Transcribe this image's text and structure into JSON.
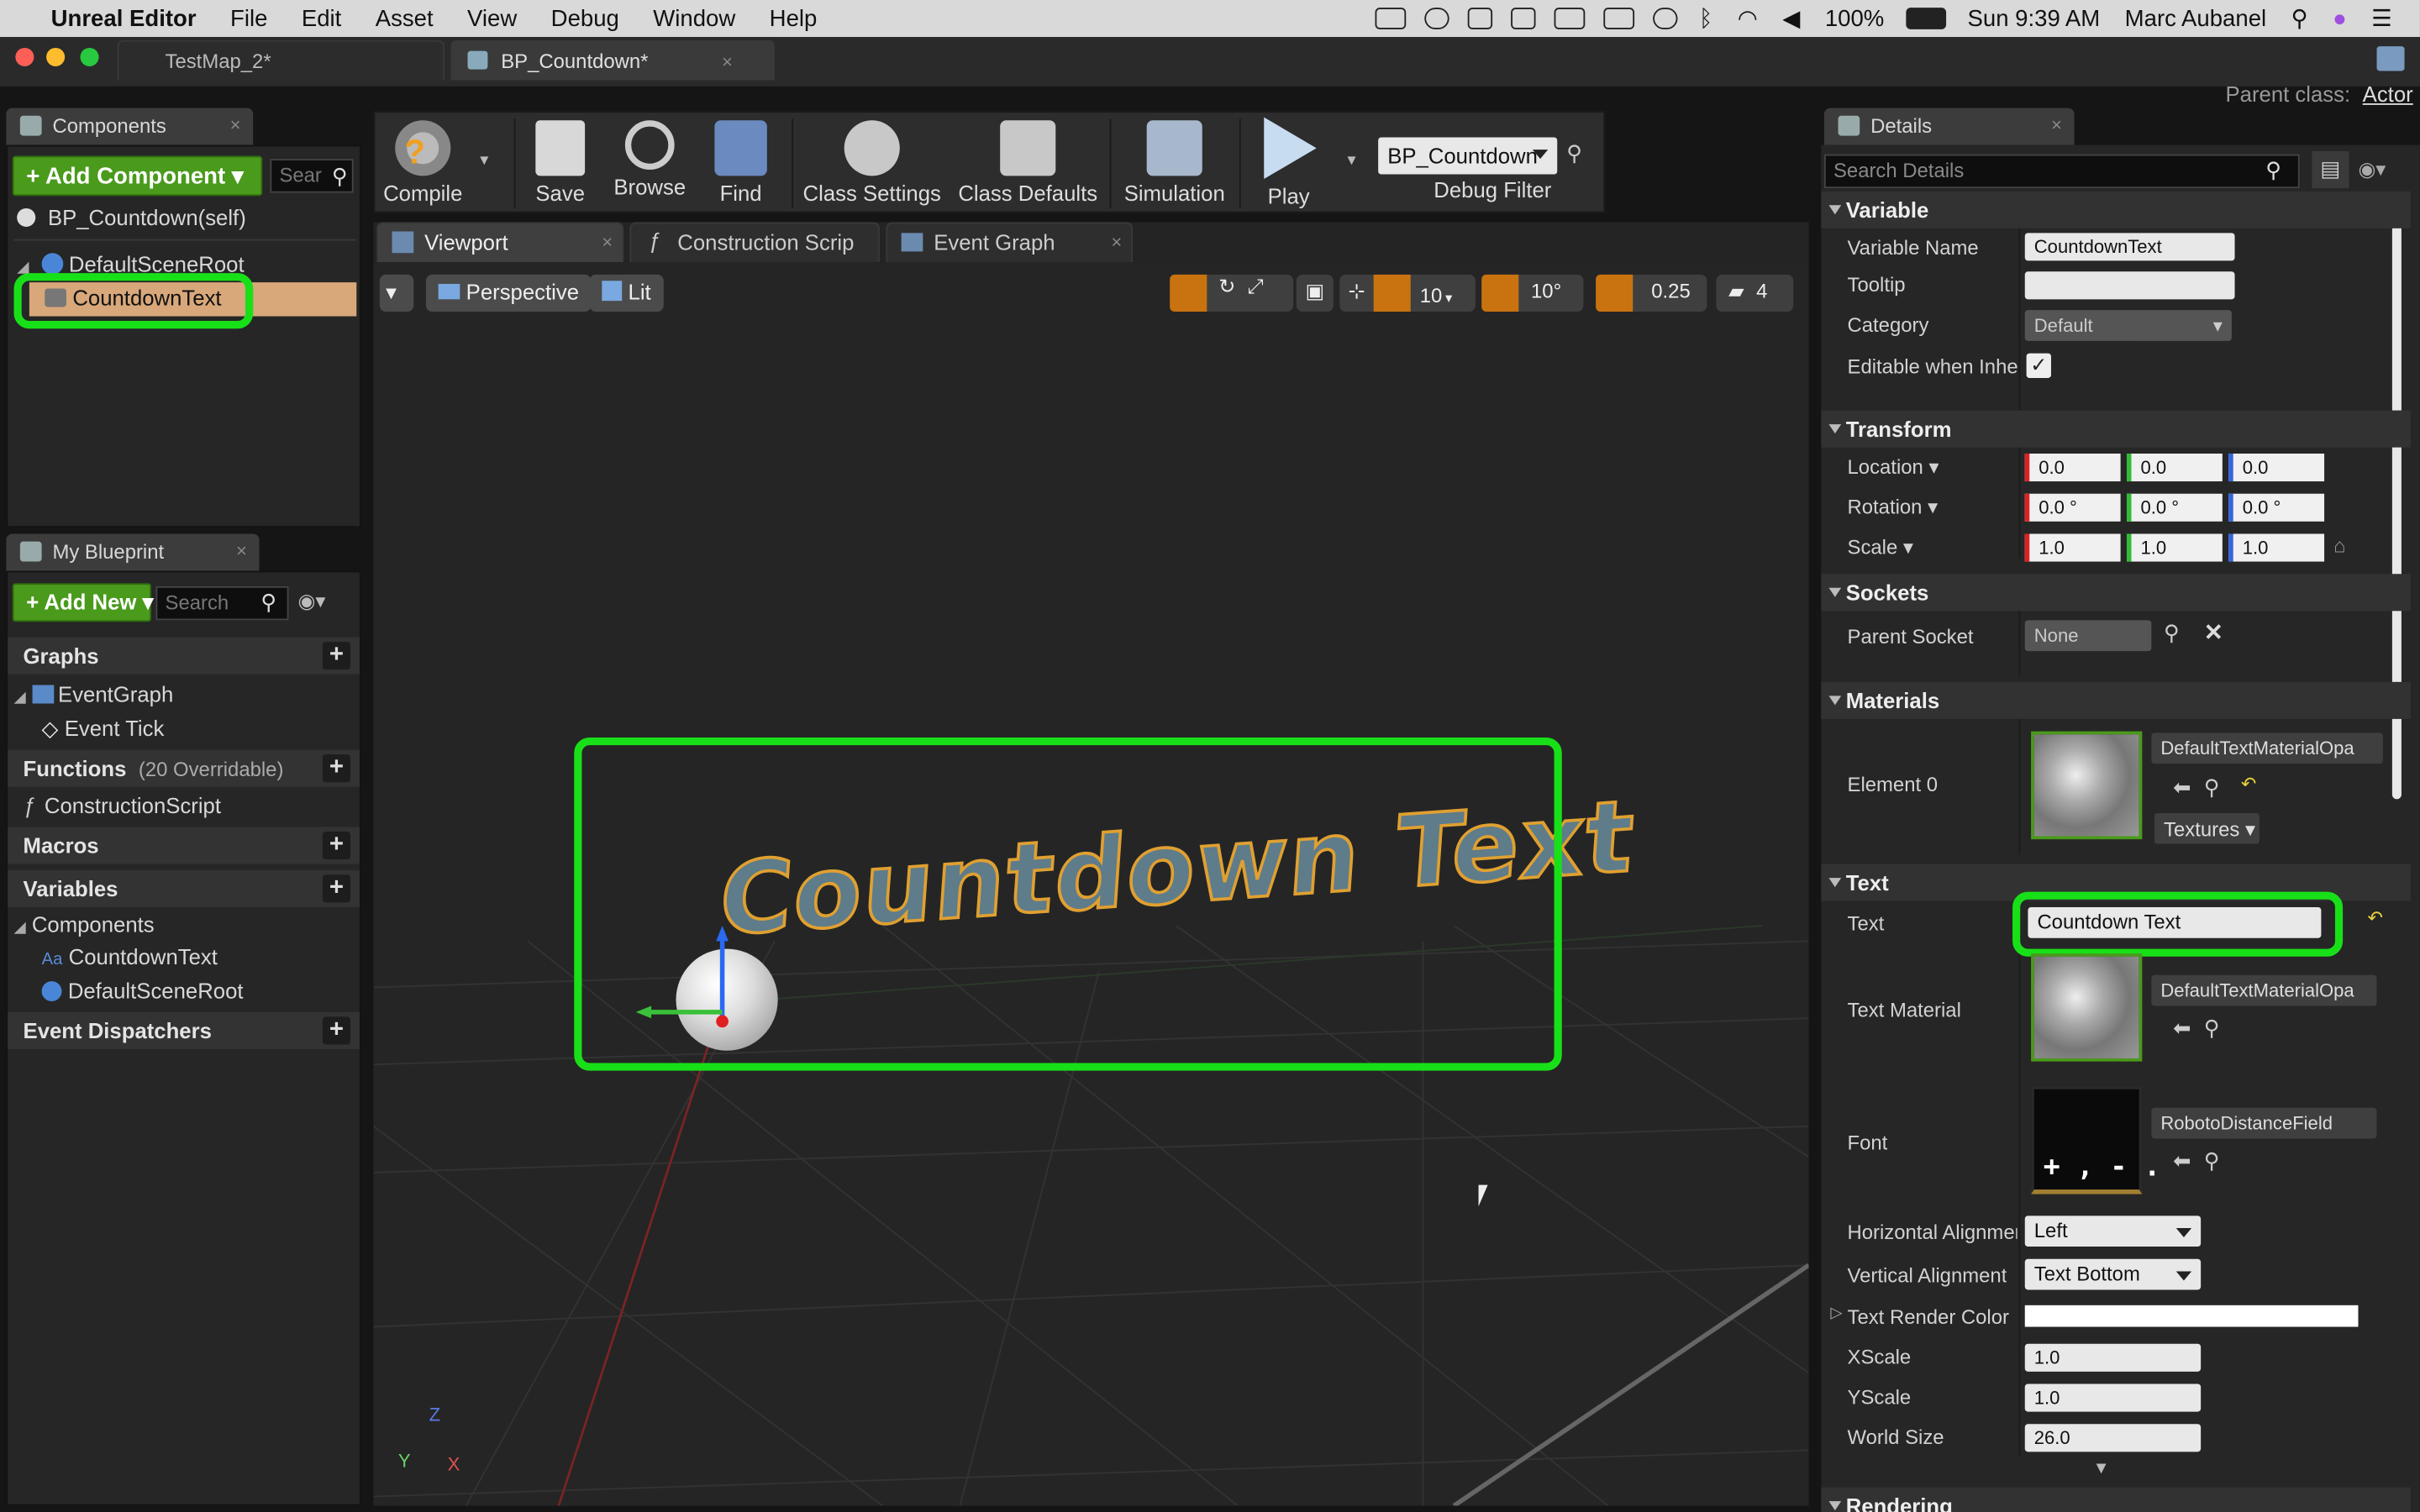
{
  "menubar": {
    "app_name": "Unreal Editor",
    "items": [
      "File",
      "Edit",
      "Asset",
      "View",
      "Debug",
      "Window",
      "Help"
    ],
    "battery": "100%",
    "clock": "Sun 9:39 AM",
    "user": "Marc Aubanel"
  },
  "doc_tabs": [
    {
      "label": "TestMap_2*"
    },
    {
      "label": "BP_Countdown*"
    }
  ],
  "parent_class": {
    "label": "Parent class:",
    "value": "Actor"
  },
  "components_panel": {
    "tab_label": "Components",
    "add_button": "+ Add Component",
    "search_placeholder": "Sear",
    "self_item": "BP_Countdown(self)",
    "root_item": "DefaultSceneRoot",
    "child_item": "CountdownText"
  },
  "my_blueprint": {
    "tab_label": "My Blueprint",
    "add_button": "+ Add New",
    "search_placeholder": "Search",
    "graphs_label": "Graphs",
    "event_graph": "EventGraph",
    "event_tick": "Event Tick",
    "functions_label": "Functions",
    "functions_note": "(20 Overridable)",
    "construction_script": "ConstructionScript",
    "macros_label": "Macros",
    "variables_label": "Variables",
    "components_label": "Components",
    "var_countdown": "CountdownText",
    "var_root": "DefaultSceneRoot",
    "dispatchers_label": "Event Dispatchers"
  },
  "toolbar": {
    "compile": "Compile",
    "save": "Save",
    "browse": "Browse",
    "find": "Find",
    "class_settings": "Class Settings",
    "class_defaults": "Class Defaults",
    "simulation": "Simulation",
    "play": "Play",
    "debug_object": "BP_Countdown",
    "debug_filter": "Debug Filter"
  },
  "editor_tabs": [
    {
      "label": "Viewport"
    },
    {
      "label": "Construction Scrip"
    },
    {
      "label": "Event Graph"
    }
  ],
  "viewport": {
    "perspective": "Perspective",
    "lit": "Lit",
    "grid_snap": "10",
    "rot_snap": "10°",
    "scale_snap": "0.25",
    "camera_speed": "4",
    "world_text": "Countdown Text",
    "axis_x": "X",
    "axis_y": "Y",
    "axis_z": "Z"
  },
  "details": {
    "tab_label": "Details",
    "search_placeholder": "Search Details",
    "variable_section": "Variable",
    "variable_name_label": "Variable Name",
    "variable_name_value": "CountdownText",
    "tooltip_label": "Tooltip",
    "tooltip_value": "",
    "category_label": "Category",
    "category_value": "Default",
    "editable_label": "Editable when Inherit",
    "transform_section": "Transform",
    "location_label": "Location",
    "location": [
      "0.0",
      "0.0",
      "0.0"
    ],
    "rotation_label": "Rotation",
    "rotation": [
      "0.0 °",
      "0.0 °",
      "0.0 °"
    ],
    "scale_label": "Scale",
    "scale": [
      "1.0",
      "1.0",
      "1.0"
    ],
    "sockets_section": "Sockets",
    "parent_socket_label": "Parent Socket",
    "parent_socket_value": "None",
    "materials_section": "Materials",
    "element0_label": "Element 0",
    "element0_material": "DefaultTextMaterialOpa",
    "textures_button": "Textures",
    "text_section": "Text",
    "text_label": "Text",
    "text_value": "Countdown Text",
    "text_material_label": "Text Material",
    "text_material_value": "DefaultTextMaterialOpa",
    "font_label": "Font",
    "font_value": "RobotoDistanceField",
    "halign_label": "Horizontal Alignmen",
    "halign_value": "Left",
    "valign_label": "Vertical Alignment",
    "valign_value": "Text Bottom",
    "render_color_label": "Text Render Color",
    "xscale_label": "XScale",
    "xscale_value": "1.0",
    "yscale_label": "YScale",
    "yscale_value": "1.0",
    "world_size_label": "World Size",
    "world_size_value": "26.0",
    "rendering_section": "Rendering"
  },
  "colors": {
    "highlight": "#18e018",
    "accent_green": "#4a9a1c",
    "accent_orange": "#c8730f"
  }
}
